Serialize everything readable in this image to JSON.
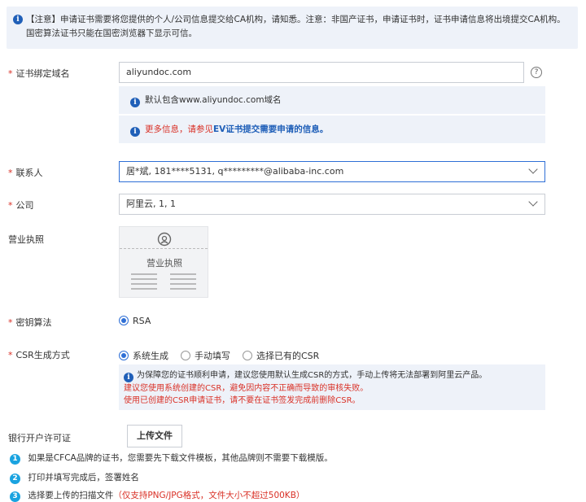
{
  "notice": {
    "text": "【注意】申请证书需要将您提供的个人/公司信息提交给CA机构，请知悉。注意：非国产证书，申请证书时，证书申请信息将出境提交CA机构。国密算法证书只能在国密浏览器下显示可信。"
  },
  "domain": {
    "label": "证书绑定域名",
    "value": "aliyundoc.com",
    "help": "?",
    "tip1": "默认包含www.aliyundoc.com域名",
    "tip2_red": "更多信息，请参见",
    "tip2_link": "EV证书提交需要申请的信息。"
  },
  "contact": {
    "label": "联系人",
    "value": "居*斌, 181****5131, q*********@alibaba-inc.com"
  },
  "company": {
    "label": "公司",
    "value": "阿里云, 1, 1"
  },
  "license": {
    "label": "营业执照",
    "placeholder": "营业执照"
  },
  "algorithm": {
    "label": "密钥算法",
    "options": [
      "RSA"
    ]
  },
  "csr": {
    "label": "CSR生成方式",
    "options": [
      "系统生成",
      "手动填写",
      "选择已有的CSR"
    ],
    "info": "为保障您的证书顺利申请，建议您使用默认生成CSR的方式，手动上传将无法部署到阿里云产品。",
    "warn1": "建议您使用系统创建的CSR，避免因内容不正确而导致的审核失败。",
    "warn2": "使用已创建的CSR申请证书，请不要在证书签发完成前删除CSR。"
  },
  "bank": {
    "label": "银行开户许可证",
    "upload_button": "上传文件"
  },
  "steps": [
    {
      "num": "1",
      "text": "如果是CFCA品牌的证书，您需要先下载文件模板，其他品牌则不需要下载模版。",
      "note": ""
    },
    {
      "num": "2",
      "text": "打印并填写完成后，签署姓名",
      "note": ""
    },
    {
      "num": "3",
      "text": "选择要上传的扫描文件",
      "note": "（仅支持PNG/JPG格式，文件大小不超过500KB）"
    }
  ],
  "colors": {
    "accent": "#2f6fd6",
    "required": "#d93026",
    "info_bg": "#eef2f9",
    "step_badge": "#1aa3e0"
  }
}
